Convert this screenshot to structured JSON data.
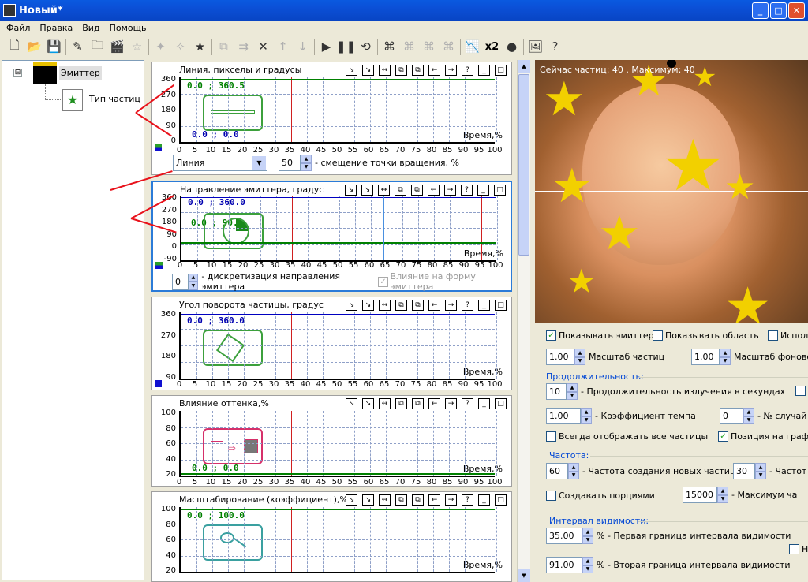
{
  "window": {
    "title": "Новый*",
    "min": "_",
    "max": "□",
    "close": "✕"
  },
  "menu": [
    "Файл",
    "Правка",
    "Вид",
    "Помощь"
  ],
  "toolbar": {
    "multiplier": "x2"
  },
  "tree": {
    "root_label": "Эмиттер",
    "child_label": "Тип частиц",
    "expander": "⊟"
  },
  "panels": [
    {
      "title": "Линия, пикселы и градусы",
      "yticks": [
        "360",
        "270",
        "180",
        "90",
        "0"
      ],
      "coord": "0.0 ; 360.5",
      "coord2": "0.0 ; 0.0",
      "time": "Время,%"
    },
    {
      "title": "Направление эмиттера, градус",
      "yticks": [
        "360",
        "270",
        "180",
        "90",
        "0",
        "-90"
      ],
      "coord": "0.0 ; 360.0",
      "coord2": "0.0 ; 90.0",
      "time": "Время,%"
    },
    {
      "title": "Угол поворота частицы, градус",
      "yticks": [
        "360",
        "270",
        "180",
        "90"
      ],
      "coord": "0.0 ; 360.0",
      "time": "Время,%"
    },
    {
      "title": "Влияние оттенка,%",
      "yticks": [
        "100",
        "80",
        "60",
        "40",
        "20"
      ],
      "coord2": "0.0 ; 0.0",
      "time": "Время,%"
    },
    {
      "title": "Масштабирование (коэффициент),%",
      "yticks": [
        "100",
        "80",
        "60",
        "40",
        "20"
      ],
      "coord": "0.0 ; 100.0",
      "time": "Время,%"
    }
  ],
  "xticks": [
    "0",
    "5",
    "10",
    "15",
    "20",
    "25",
    "30",
    "35",
    "40",
    "45",
    "50",
    "55",
    "60",
    "65",
    "70",
    "75",
    "80",
    "85",
    "90",
    "95",
    "100"
  ],
  "panel_icons": [
    "↘",
    "↘",
    "↔",
    "⧉",
    "⧉",
    "←",
    "→",
    "?",
    "_",
    "□"
  ],
  "line_controls": {
    "select_value": "Линия",
    "offset_value": "50",
    "offset_label": "- смещение точки вращения, %"
  },
  "dir_controls": {
    "disc_value": "0",
    "disc_label": "- дискретизация направления эмиттера",
    "influence_label": "Влияние на форму эмиттера"
  },
  "preview": {
    "status": "Сейчас частиц: 40 . Максимум: 40"
  },
  "props": {
    "show_emitter": "Показывать эмиттер",
    "show_area": "Показывать область",
    "use": "Испол",
    "scale_val": "1.00",
    "scale_label": "Масштаб частиц",
    "bg_scale_val": "1.00",
    "bg_scale_label": "Масштаб фоново",
    "duration_group": "Продолжительность:",
    "dur_val": "10",
    "dur_label": "- Продолжительность излучения в секундах",
    "tempo_val": "1.00",
    "tempo_label": "- Коэффициент темпа",
    "rand_val": "0",
    "rand_label": "- № случай",
    "always_show": "Всегда отображать все частицы",
    "pos_graph": "Позиция на графи",
    "freq_group": "Частота:",
    "freq_val": "60",
    "freq_label": "- Частота создания новых частиц",
    "freq2_val": "30",
    "freq2_label": "- Частот",
    "portions": "Создавать порциями",
    "max_val": "15000",
    "max_label": "- Максимум ча",
    "vis_group": "Интервал видимости:",
    "vis1_val": "35.00",
    "vis1_label": "% - Первая граница интервала видимости",
    "vis2_val": "91.00",
    "vis2_label": "% - Вторая граница интервала видимости",
    "vis_h": "Н"
  }
}
